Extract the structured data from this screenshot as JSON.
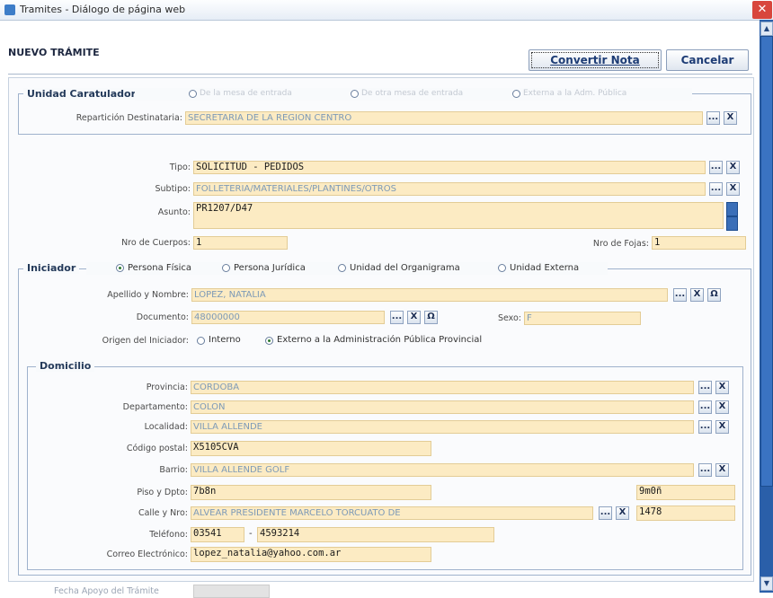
{
  "window": {
    "title": "Tramites - Diálogo de página web",
    "close_glyph": "✕"
  },
  "header": {
    "title": "NUEVO TRÁMITE",
    "convert_label": "Convertir Nota",
    "cancel_label": "Cancelar"
  },
  "unidad": {
    "legend": "Unidad Caratuladora",
    "disabled_opts": [
      "De la mesa de entrada",
      "De otra mesa de entrada",
      "Externa a la Adm. Pública"
    ],
    "reparticion_label": "Repartición Destinataria:",
    "reparticion_value": "SECRETARIA DE LA REGION CENTRO"
  },
  "tramite": {
    "tipo_label": "Tipo:",
    "tipo_value": "SOLICITUD - PEDIDOS",
    "subtipo_label": "Subtipo:",
    "subtipo_value": "FOLLETERIA/MATERIALES/PLANTINES/OTROS",
    "asunto_label": "Asunto:",
    "asunto_value": "PR1207/D47",
    "cuerpos_label": "Nro de Cuerpos:",
    "cuerpos_value": "1",
    "fojas_label": "Nro de Fojas:",
    "fojas_value": "1"
  },
  "iniciador": {
    "legend": "Iniciador",
    "types": [
      "Persona Física",
      "Persona Jurídica",
      "Unidad del Organigrama",
      "Unidad Externa"
    ],
    "apellido_label": "Apellido y Nombre:",
    "apellido_value": "LOPEZ, NATALIA",
    "documento_label": "Documento:",
    "documento_value": "48000000",
    "sexo_label": "Sexo:",
    "sexo_value": "F",
    "origen_label": "Origen del Iniciador:",
    "origen_opts": [
      "Interno",
      "Externo a la Administración Pública Provincial"
    ]
  },
  "domicilio": {
    "legend": "Domicilio",
    "provincia_label": "Provincia:",
    "provincia_value": "CORDOBA",
    "departamento_label": "Departamento:",
    "departamento_value": "COLON",
    "localidad_label": "Localidad:",
    "localidad_value": "VILLA ALLENDE",
    "cp_label": "Código postal:",
    "cp_value": "X5105CVA",
    "barrio_label": "Barrio:",
    "barrio_value": "VILLA ALLENDE GOLF",
    "piso_label": "Piso y Dpto:",
    "piso_value": "7b8n",
    "dpto_value": "9m0ñ",
    "calle_label": "Calle y Nro:",
    "calle_value": "ALVEAR PRESIDENTE MARCELO TORCUATO DE",
    "nro_value": "1478",
    "telefono_label": "Teléfono:",
    "tel_area": "03541",
    "tel_dash": "-",
    "tel_num": "4593214",
    "correo_label": "Correo Electrónico:",
    "correo_value": "lopez_natalia@yahoo.com.ar"
  },
  "footer": {
    "label": "Fecha Apoyo del Trámite"
  },
  "glyphs": {
    "dots": "...",
    "clear": "X",
    "person": "Ω",
    "up": "▲",
    "down": "▼"
  },
  "colors": {
    "field_bg": "#fcebc3",
    "field_border": "#e3cc96",
    "legend_text": "#243a5a"
  }
}
